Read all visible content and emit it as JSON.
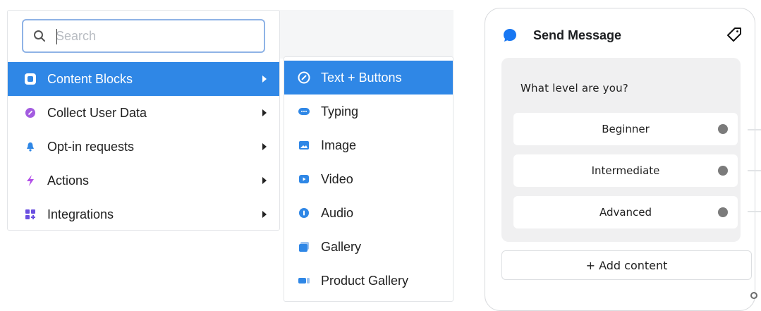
{
  "search": {
    "placeholder": "Search",
    "value": ""
  },
  "menu": {
    "items": [
      {
        "label": "Content Blocks",
        "icon": "content-blocks-icon",
        "active": true
      },
      {
        "label": "Collect User Data",
        "icon": "collect-data-icon"
      },
      {
        "label": "Opt-in requests",
        "icon": "bell-icon"
      },
      {
        "label": "Actions",
        "icon": "lightning-icon"
      },
      {
        "label": "Integrations",
        "icon": "integrations-icon"
      }
    ]
  },
  "submenu": {
    "items": [
      {
        "label": "Text + Buttons",
        "icon": "text-buttons-icon",
        "active": true
      },
      {
        "label": "Typing",
        "icon": "typing-icon"
      },
      {
        "label": "Image",
        "icon": "image-icon"
      },
      {
        "label": "Video",
        "icon": "video-icon"
      },
      {
        "label": "Audio",
        "icon": "audio-icon"
      },
      {
        "label": "Gallery",
        "icon": "gallery-icon"
      },
      {
        "label": "Product Gallery",
        "icon": "product-gallery-icon"
      }
    ]
  },
  "card": {
    "title": "Send Message",
    "prompt": "What level are you?",
    "options": [
      "Beginner",
      "Intermediate",
      "Advanced"
    ],
    "add_content": "+ Add content"
  },
  "colors": {
    "accent": "#2f87e6",
    "collect": "#a35ce0",
    "bell": "#2f87e6",
    "lightning": "#b24fe8"
  }
}
